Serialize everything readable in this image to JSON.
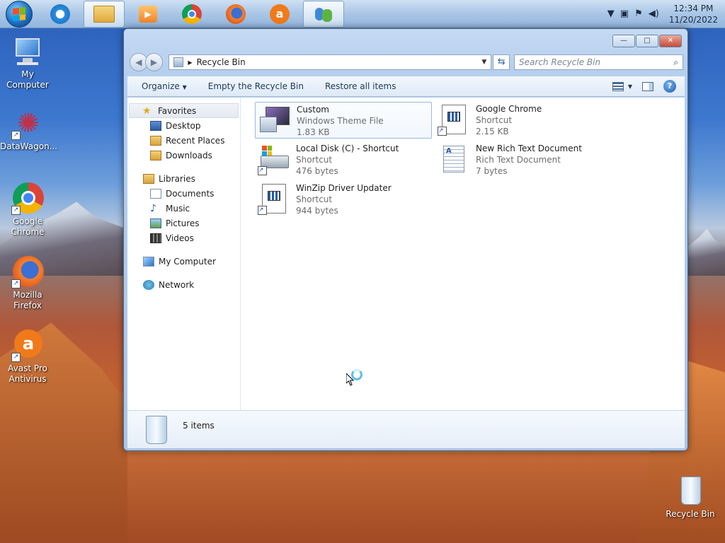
{
  "taskbar": {
    "clock_time": "12:34 PM",
    "clock_date": "11/20/2022",
    "pinned": [
      {
        "name": "ie-icon",
        "color": "#2a8fe0",
        "active": false
      },
      {
        "name": "folder-icon",
        "color": "#e4b84f",
        "active": true
      },
      {
        "name": "media-player-icon",
        "color": "#f29a2e",
        "active": false
      },
      {
        "name": "chrome-icon",
        "color": "#3a9b3f",
        "active": false
      },
      {
        "name": "firefox-icon",
        "color": "#ee6b22",
        "active": false
      },
      {
        "name": "avast-icon",
        "color": "#f07a1a",
        "active": false
      },
      {
        "name": "network-people-icon",
        "color": "#4ca23a",
        "active": true
      }
    ]
  },
  "desktop": {
    "icons": [
      {
        "label": "My Computer",
        "icon": "computer-icon"
      },
      {
        "label": "DataWagon...",
        "icon": "datawagon-icon"
      },
      {
        "label": "Google Chrome",
        "icon": "chrome-icon"
      },
      {
        "label": "Mozilla Firefox",
        "icon": "firefox-icon"
      },
      {
        "label": "Avast Pro Antivirus",
        "icon": "avast-icon"
      },
      {
        "label": "Recycle Bin",
        "icon": "recycle-bin-icon"
      }
    ]
  },
  "window": {
    "caption_minimize": "—",
    "caption_maximize": "□",
    "caption_close": "✕",
    "address": "Recycle Bin",
    "search_placeholder": "Search Recycle Bin",
    "toolbar": {
      "organize": "Organize",
      "empty": "Empty the Recycle Bin",
      "restore": "Restore all items"
    },
    "nav": {
      "favorites": "Favorites",
      "desktop": "Desktop",
      "recent": "Recent Places",
      "downloads": "Downloads",
      "libraries": "Libraries",
      "documents": "Documents",
      "music": "Music",
      "pictures": "Pictures",
      "videos": "Videos",
      "computer": "My Computer",
      "network": "Network"
    },
    "files": [
      {
        "name": "Custom",
        "type": "Windows Theme File",
        "size": "1.83 KB"
      },
      {
        "name": "Google Chrome",
        "type": "Shortcut",
        "size": "2.15 KB"
      },
      {
        "name": "Local Disk (C) - Shortcut",
        "type": "Shortcut",
        "size": "476 bytes"
      },
      {
        "name": "New Rich Text Document",
        "type": "Rich Text Document",
        "size": "7 bytes"
      },
      {
        "name": "WinZip Driver Updater",
        "type": "Shortcut",
        "size": "944 bytes"
      }
    ],
    "status": "5 items"
  }
}
